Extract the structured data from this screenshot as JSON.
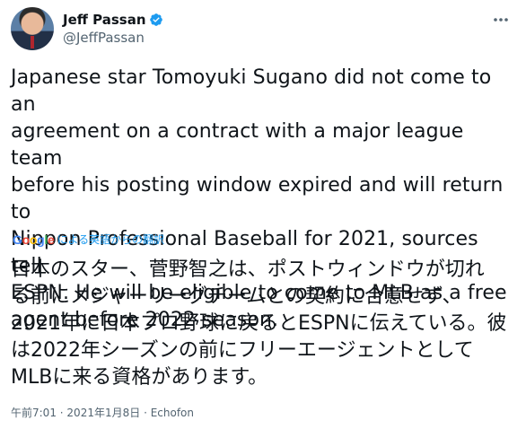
{
  "author": {
    "display_name": "Jeff Passan",
    "handle": "@JeffPassan",
    "verified": true
  },
  "icons": {
    "verified": "verified-badge-icon",
    "more": "more-options-icon",
    "google": "google-logo"
  },
  "colors": {
    "accent": "#1d9bf0",
    "secondary_text": "#536471",
    "text": "#0f1419"
  },
  "tweet": {
    "text": "Japanese star Tomoyuki Sugano did not come to an\nagreement on a contract with a major league team\nbefore his posting window expired and will return to\nNippon Professional Baseball for 2021, sources tell\nESPN. He will be eligible to come to MLB as a free\nagent before 2022 season."
  },
  "translate": {
    "google_logo_text": "Google",
    "label": "による英語からの翻訳"
  },
  "translation": {
    "text": "日本のスター、菅野智之は、ポストウィンドウが切れ\nる前にメジャーリーグチームとの契約に合意せず、\n2021年に日本プロ野球に戻るとESPNに伝えている。彼\nは2022年シーズンの前にフリーエージェントとして\nMLBに来る資格があります。"
  },
  "meta": {
    "time": "午前7:01",
    "date": "2021年1月8日",
    "separator": "·",
    "source": "Echofon"
  }
}
